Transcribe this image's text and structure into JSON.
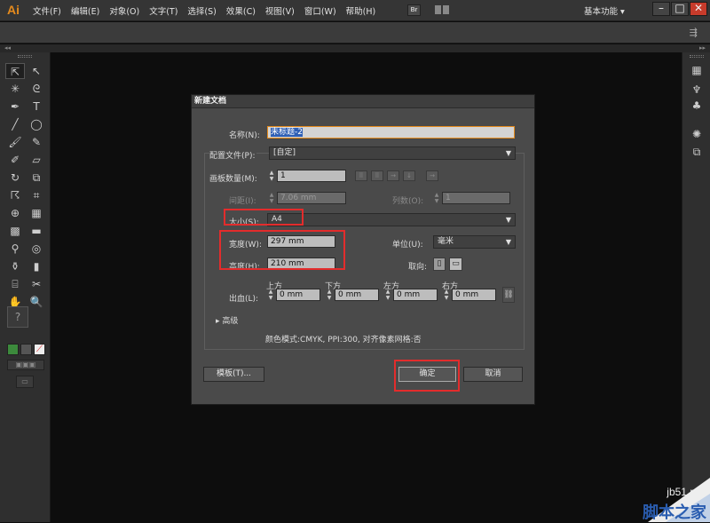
{
  "app": {
    "logo": "Ai",
    "menus": [
      "文件(F)",
      "编辑(E)",
      "对象(O)",
      "文字(T)",
      "选择(S)",
      "效果(C)",
      "视图(V)",
      "窗口(W)",
      "帮助(H)"
    ],
    "bridge": "Br",
    "workspace": "基本功能",
    "window_controls": {
      "minimize": "–",
      "restore": "□",
      "close": "✕"
    }
  },
  "dialog": {
    "title": "新建文档",
    "name_label": "名称(N):",
    "name_value": "未标题-2",
    "profile_label": "配置文件(P):",
    "profile_value": "[自定]",
    "artboards_label": "画板数量(M):",
    "artboards_value": "1",
    "spacing_label": "间距(I):",
    "spacing_value": "7.06 mm",
    "columns_label": "列数(O):",
    "columns_value": "1",
    "size_label": "大小(S):",
    "size_value": "A4",
    "width_label": "宽度(W):",
    "width_value": "297 mm",
    "height_label": "高度(H):",
    "height_value": "210 mm",
    "units_label": "单位(U):",
    "units_value": "毫米",
    "orientation_label": "取向:",
    "bleed_label": "出血(L):",
    "bleed": [
      {
        "label": "上方",
        "value": "0 mm"
      },
      {
        "label": "下方",
        "value": "0 mm"
      },
      {
        "label": "左方",
        "value": "0 mm"
      },
      {
        "label": "右方",
        "value": "0 mm"
      }
    ],
    "advanced_label": "高级",
    "color_info": "颜色模式:CMYK, PPI:300, 对齐像素网格:否",
    "templates_button": "模板(T)...",
    "ok_button": "确定",
    "cancel_button": "取消"
  },
  "watermark": {
    "site": "jb51.net",
    "name": "脚本之家"
  },
  "colors": {
    "accent": "#e58b1d",
    "highlight": "#e32c2c"
  }
}
